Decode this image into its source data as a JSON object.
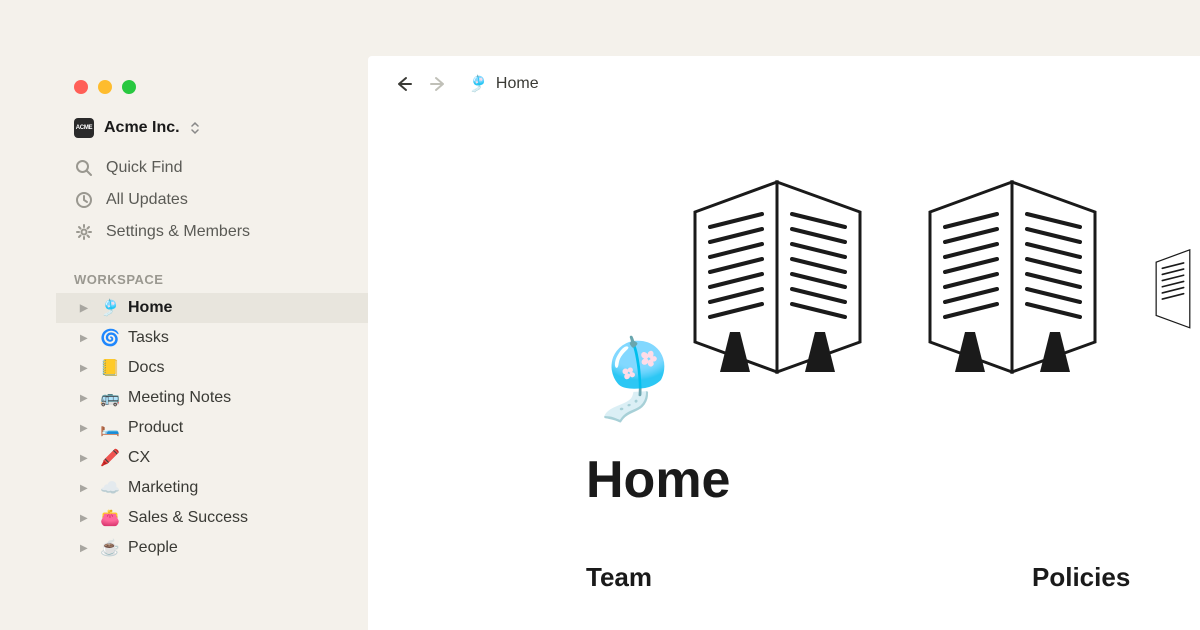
{
  "workspace": {
    "name": "Acme Inc.",
    "logo_text": "ACME"
  },
  "sidebar": {
    "links": [
      {
        "label": "Quick Find",
        "icon": "search"
      },
      {
        "label": "All Updates",
        "icon": "clock"
      },
      {
        "label": "Settings & Members",
        "icon": "gear"
      }
    ],
    "section_label": "Workspace",
    "pages": [
      {
        "emoji": "🎐",
        "label": "Home",
        "active": true
      },
      {
        "emoji": "🌀",
        "label": "Tasks",
        "active": false
      },
      {
        "emoji": "📒",
        "label": "Docs",
        "active": false
      },
      {
        "emoji": "🚌",
        "label": "Meeting Notes",
        "active": false
      },
      {
        "emoji": "🛏️",
        "label": "Product",
        "active": false
      },
      {
        "emoji": "🖍️",
        "label": "CX",
        "active": false
      },
      {
        "emoji": "☁️",
        "label": "Marketing",
        "active": false
      },
      {
        "emoji": "👛",
        "label": "Sales & Success",
        "active": false
      },
      {
        "emoji": "☕",
        "label": "People",
        "active": false
      }
    ]
  },
  "breadcrumb": {
    "icon": "🎐",
    "label": "Home"
  },
  "page": {
    "icon": "🎐",
    "title": "Home",
    "columns": [
      {
        "heading": "Team"
      },
      {
        "heading": "Policies"
      }
    ]
  }
}
